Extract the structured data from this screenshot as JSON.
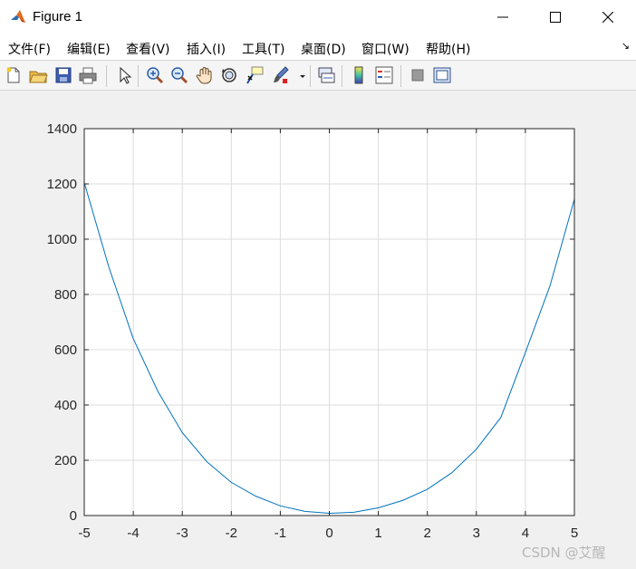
{
  "window": {
    "title": "Figure 1"
  },
  "menu": {
    "items": [
      "文件(F)",
      "编辑(E)",
      "查看(V)",
      "插入(I)",
      "工具(T)",
      "桌面(D)",
      "窗口(W)",
      "帮助(H)"
    ]
  },
  "toolbar": {
    "icons": [
      "new-figure-icon",
      "open-file-icon",
      "save-icon",
      "print-icon",
      "select-arrow-icon",
      "zoom-in-icon",
      "zoom-out-icon",
      "pan-hand-icon",
      "rotate-3d-icon",
      "data-cursor-icon",
      "brush-icon",
      "link-plot-icon",
      "colorbar-icon",
      "legend-icon",
      "hide-plot-tools-icon",
      "show-plot-tools-icon"
    ]
  },
  "colors": {
    "line": "#0072BD",
    "grid": "#dcdcdc",
    "axes_bg": "#ffffff",
    "figure_bg": "#f0f0f0"
  },
  "chart_data": {
    "type": "line",
    "title": "",
    "xlabel": "",
    "ylabel": "",
    "xlim": [
      -5,
      5
    ],
    "ylim": [
      0,
      1400
    ],
    "xticks": [
      -5,
      -4,
      -3,
      -2,
      -1,
      0,
      1,
      2,
      3,
      4,
      5
    ],
    "yticks": [
      0,
      200,
      400,
      600,
      800,
      1000,
      1200,
      1400
    ],
    "grid": true,
    "series": [
      {
        "x": [
          -5,
          -4.5,
          -4,
          -3.5,
          -3,
          -2.5,
          -2,
          -1.5,
          -1,
          -0.5,
          0,
          0.5,
          1,
          1.5,
          2,
          2.5,
          3,
          3.5,
          4,
          4.5,
          5
        ],
        "y": [
          1205,
          900,
          640,
          450,
          300,
          195,
          120,
          70,
          35,
          15,
          8,
          12,
          28,
          55,
          95,
          155,
          240,
          355,
          590,
          830,
          1145
        ]
      }
    ]
  },
  "watermark": "CSDN @艾醒"
}
